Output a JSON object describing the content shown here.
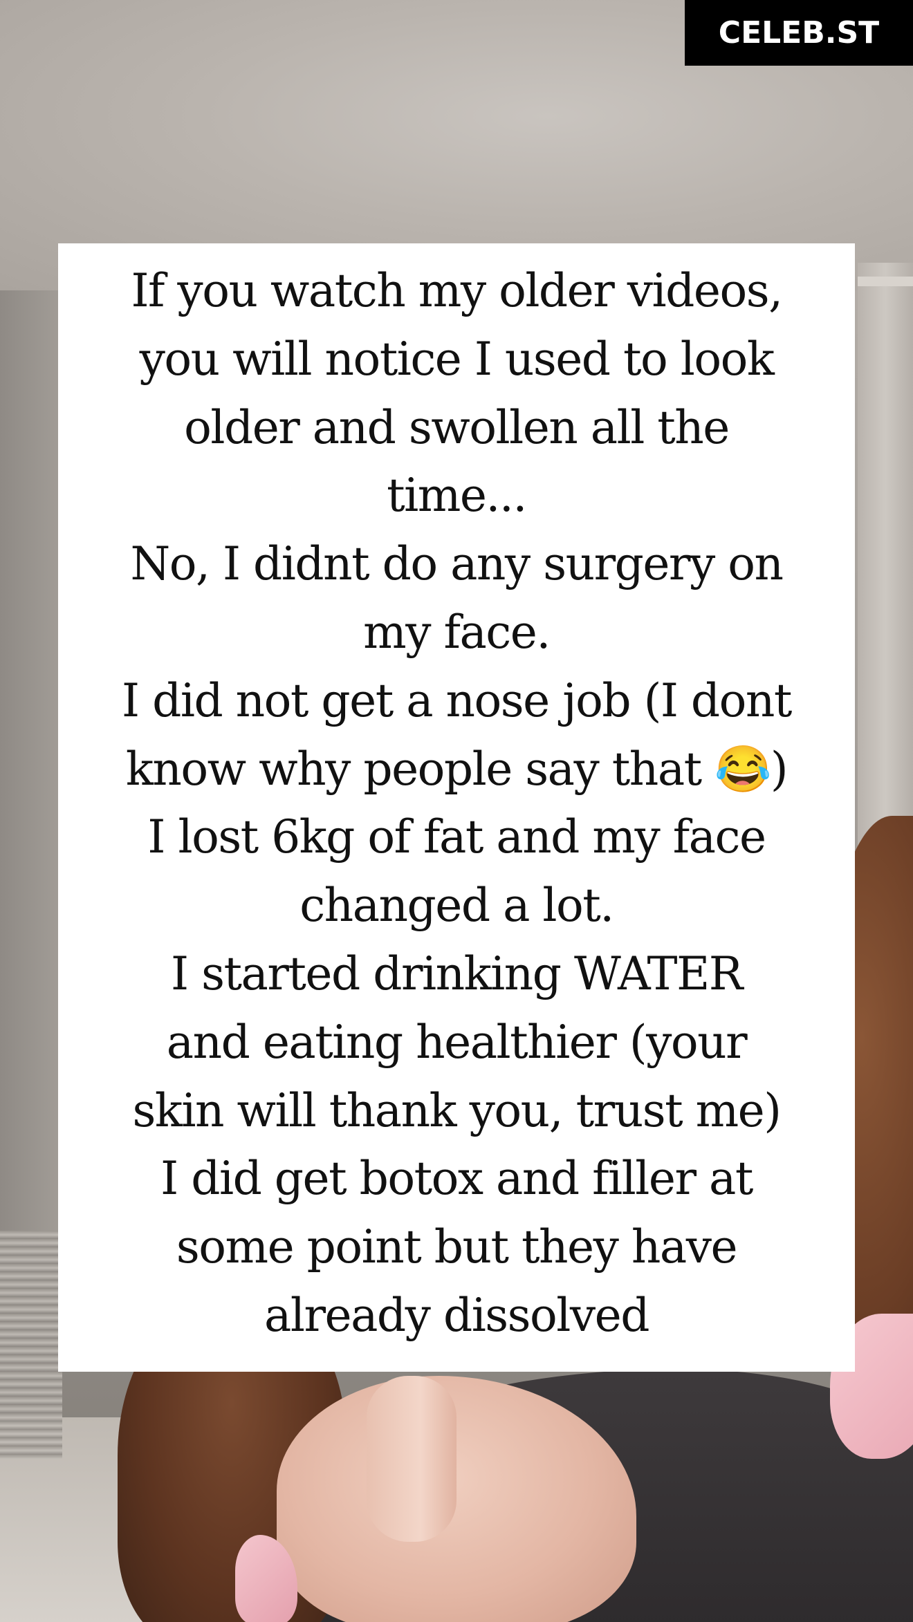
{
  "brand": {
    "badge_label": "CELEB.ST"
  },
  "caption": {
    "lines": [
      "If you watch my older videos,",
      "you will notice I used to look",
      "older and swollen all the",
      "time...",
      "No, I didnt do any surgery on",
      "my face.",
      "I did not get a nose job (I dont",
      "know why people say that 😂)",
      "I lost 6kg of fat and my face",
      "changed a lot.",
      "I started drinking WATER",
      "and eating healthier (your",
      "skin will thank you, trust me)",
      "I did get botox and filler at",
      "some point but they have",
      "already dissolved"
    ]
  },
  "colors": {
    "badge_background": "#000000",
    "badge_text": "#ffffff",
    "card_background": "#ffffff",
    "card_text": "#111111"
  }
}
